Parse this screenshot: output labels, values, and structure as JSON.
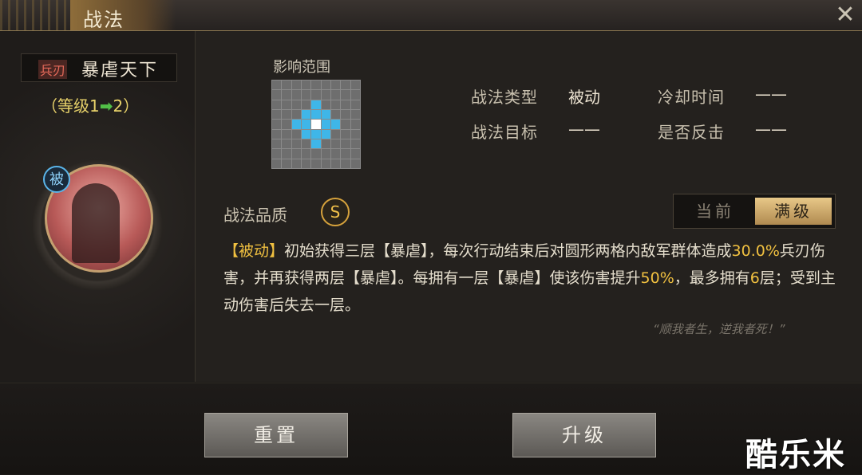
{
  "header": {
    "title": "战法",
    "close_icon": "close-icon"
  },
  "tactic": {
    "type_tag": "兵刃",
    "name": "暴虐天下",
    "level_prefix": "（等级1",
    "level_arrow": "➡",
    "level_suffix": "2）",
    "passive_badge": "被"
  },
  "range": {
    "label": "影响范围",
    "grid_size": 9,
    "hit_cells": [
      [
        4,
        2
      ],
      [
        3,
        3
      ],
      [
        4,
        3
      ],
      [
        5,
        3
      ],
      [
        2,
        4
      ],
      [
        3,
        4
      ],
      [
        5,
        4
      ],
      [
        6,
        4
      ],
      [
        3,
        5
      ],
      [
        4,
        5
      ],
      [
        5,
        5
      ],
      [
        4,
        6
      ]
    ],
    "center_cell": [
      4,
      4
    ]
  },
  "info": {
    "type_label": "战法类型",
    "type_value": "被动",
    "cooldown_label": "冷却时间",
    "cooldown_value": "——",
    "target_label": "战法目标",
    "target_value": "——",
    "counter_label": "是否反击",
    "counter_value": "——"
  },
  "quality": {
    "label": "战法品质",
    "grade": "S"
  },
  "toggle": {
    "current": "当前",
    "max": "满级",
    "selected": "max"
  },
  "description": {
    "tag": "【被动】",
    "part1": "初始获得三层【暴虐】，每次行动结束后对圆形两格内敌军群体造成",
    "value1": "30.0%",
    "part2": "兵刃伤害，并再获得两层【暴虐】。每拥有一层【暴虐】使该伤害提升",
    "value2": "50%",
    "part3": "，最多拥有",
    "value3": "6",
    "part4": "层；受到主动伤害后失去一层。"
  },
  "quote": "“顺我者生，逆我者死！”",
  "buttons": {
    "reset": "重置",
    "upgrade": "升级"
  },
  "watermark": "酷乐米",
  "colors": {
    "highlight": "#f0c040",
    "range_hit": "#3fb6e8",
    "tag_red": "#e56a5a"
  }
}
